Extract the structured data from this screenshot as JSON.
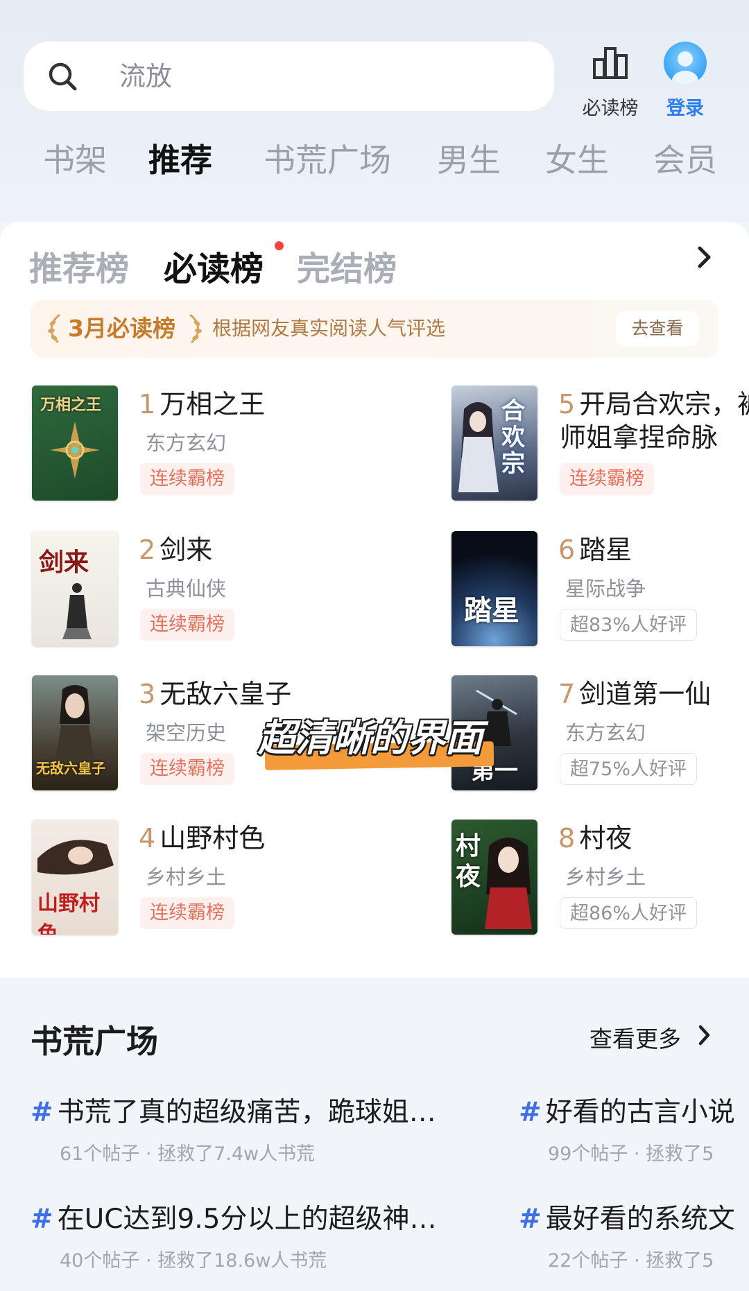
{
  "search": {
    "placeholder_text": "流放"
  },
  "top_buttons": {
    "rank_label": "必读榜",
    "login_label": "登录"
  },
  "nav_tabs": [
    "书架",
    "推荐",
    "书荒广场",
    "男生",
    "女生",
    "会员"
  ],
  "sub_tabs": [
    "推荐榜",
    "必读榜",
    "完结榜"
  ],
  "banner": {
    "title": "3月必读榜",
    "desc": "根据网友真实阅读人气评选",
    "button": "去查看"
  },
  "books": [
    {
      "num": "1",
      "title": "万相之王",
      "genre": "东方玄幻",
      "tag": "连续霸榜",
      "cover_title": "万相之王"
    },
    {
      "num": "2",
      "title": "剑来",
      "genre": "古典仙侠",
      "tag": "连续霸榜",
      "cover_title": "剑来"
    },
    {
      "num": "3",
      "title": "无敌六皇子",
      "genre": "架空历史",
      "tag": "连续霸榜",
      "cover_title": "无敌六皇子"
    },
    {
      "num": "4",
      "title": "山野村色",
      "genre": "乡村乡土",
      "tag": "连续霸榜",
      "cover_title": "山野村色"
    },
    {
      "num": "5",
      "title": "开局合欢宗，被",
      "title2": "师姐拿捏命脉",
      "genre": "",
      "tag": "连续霸榜",
      "cover_title": "合欢宗"
    },
    {
      "num": "6",
      "title": "踏星",
      "genre": "星际战争",
      "tag": "超83%人好评",
      "cover_title": "踏星"
    },
    {
      "num": "7",
      "title": "剑道第一仙",
      "genre": "东方玄幻",
      "tag": "超75%人好评",
      "cover_title": "第一仙"
    },
    {
      "num": "8",
      "title": "村夜",
      "genre": "乡村乡土",
      "tag": "超86%人好评",
      "cover_title": "村夜"
    }
  ],
  "overlay_caption": "超清晰的界面",
  "square": {
    "title": "书荒广场",
    "more": "查看更多",
    "topics": [
      {
        "title": "书荒了真的超级痛苦，跪球姐…",
        "sub": "61个帖子 · 拯救了7.4w人书荒"
      },
      {
        "title": "好看的古言小说",
        "sub": "99个帖子 · 拯救了5"
      },
      {
        "title": "在UC达到9.5分以上的超级神…",
        "sub": "40个帖子 · 拯救了18.6w人书荒"
      },
      {
        "title": "最好看的系统文",
        "sub": "22个帖子 · 拯救了5"
      }
    ]
  },
  "colors": {
    "accent_blue": "#2a7ef0",
    "rank_orange": "#c89668",
    "tag_red": "#e2725b",
    "hash_blue": "#3f6ee6"
  }
}
